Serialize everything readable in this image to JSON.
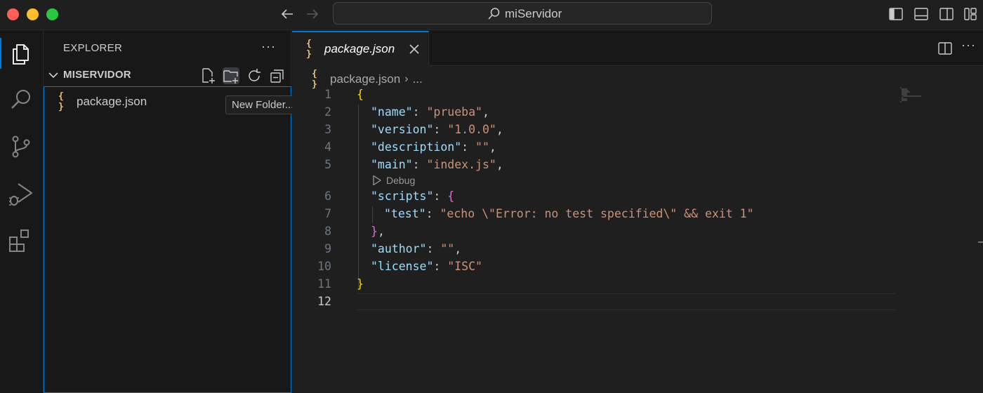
{
  "window": {
    "search_text": "miServidor"
  },
  "sidebar": {
    "title": "EXPLORER",
    "more": "···",
    "section_title": "MISERVIDOR",
    "files": [
      {
        "icon": "{ }",
        "name": "package.json"
      }
    ],
    "tooltip": "New Folder..."
  },
  "editor": {
    "tab": {
      "icon": "{ }",
      "label": "package.json"
    },
    "more": "···",
    "breadcrumb": {
      "icon": "{ }",
      "file": "package.json",
      "sep": "›",
      "rest": "..."
    },
    "codelens": "Debug",
    "line_numbers": [
      "1",
      "2",
      "3",
      "4",
      "5",
      "6",
      "7",
      "8",
      "9",
      "10",
      "11",
      "12"
    ],
    "code": {
      "l1_open": "{",
      "l2_key": "\"name\"",
      "l2_val": "\"prueba\"",
      "l3_key": "\"version\"",
      "l3_val": "\"1.0.0\"",
      "l4_key": "\"description\"",
      "l4_val": "\"\"",
      "l5_key": "\"main\"",
      "l5_val": "\"index.js\"",
      "l6_key": "\"scripts\"",
      "l6_open": "{",
      "l7_key": "\"test\"",
      "l7_val": "\"echo \\\"Error: no test specified\\\" && exit 1\"",
      "l8_close": "}",
      "l9_key": "\"author\"",
      "l9_val": "\"\"",
      "l10_key": "\"license\"",
      "l10_val": "\"ISC\"",
      "l11_close": "}",
      "colon": ": ",
      "comma": ","
    }
  }
}
